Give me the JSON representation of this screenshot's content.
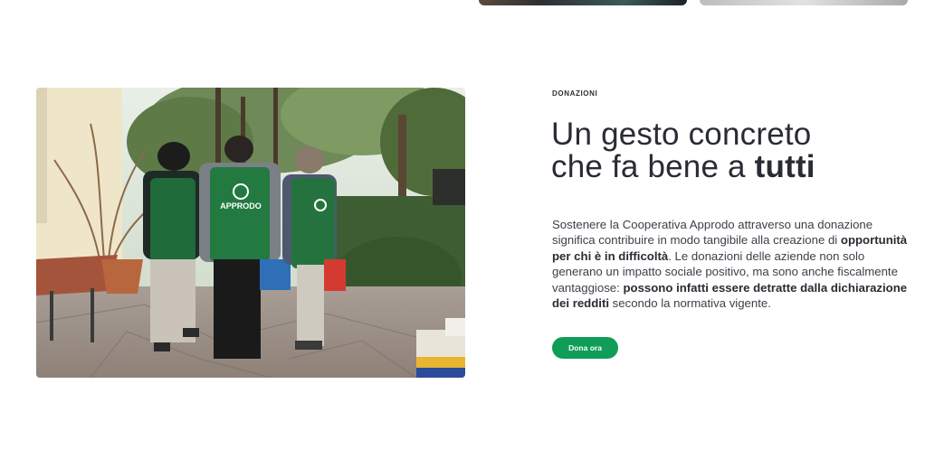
{
  "section": {
    "eyebrow": "DONAZIONI",
    "headline_line1": "Un gesto concreto",
    "headline_line2_prefix": "che fa bene a ",
    "headline_line2_bold": "tutti",
    "body": {
      "p1": "Sostenere la Cooperativa Approdo attraverso una donazione significa contribuire in modo tangibile alla creazione di ",
      "b1": "opportunità per chi è in difficoltà",
      "p2": ". Le donazioni delle aziende non solo generano un impatto sociale positivo, ma sono anche fiscalmente vantaggiose: ",
      "b2": "possono infatti essere detratte dalla dichiarazione dei redditi",
      "p3": " secondo la normativa vigente."
    },
    "cta_label": "Dona ora"
  },
  "photo": {
    "apron_text": "APPRODO"
  },
  "colors": {
    "accent": "#0f9d58",
    "text_dark": "#2a2c33",
    "text_body": "#3d4048"
  }
}
